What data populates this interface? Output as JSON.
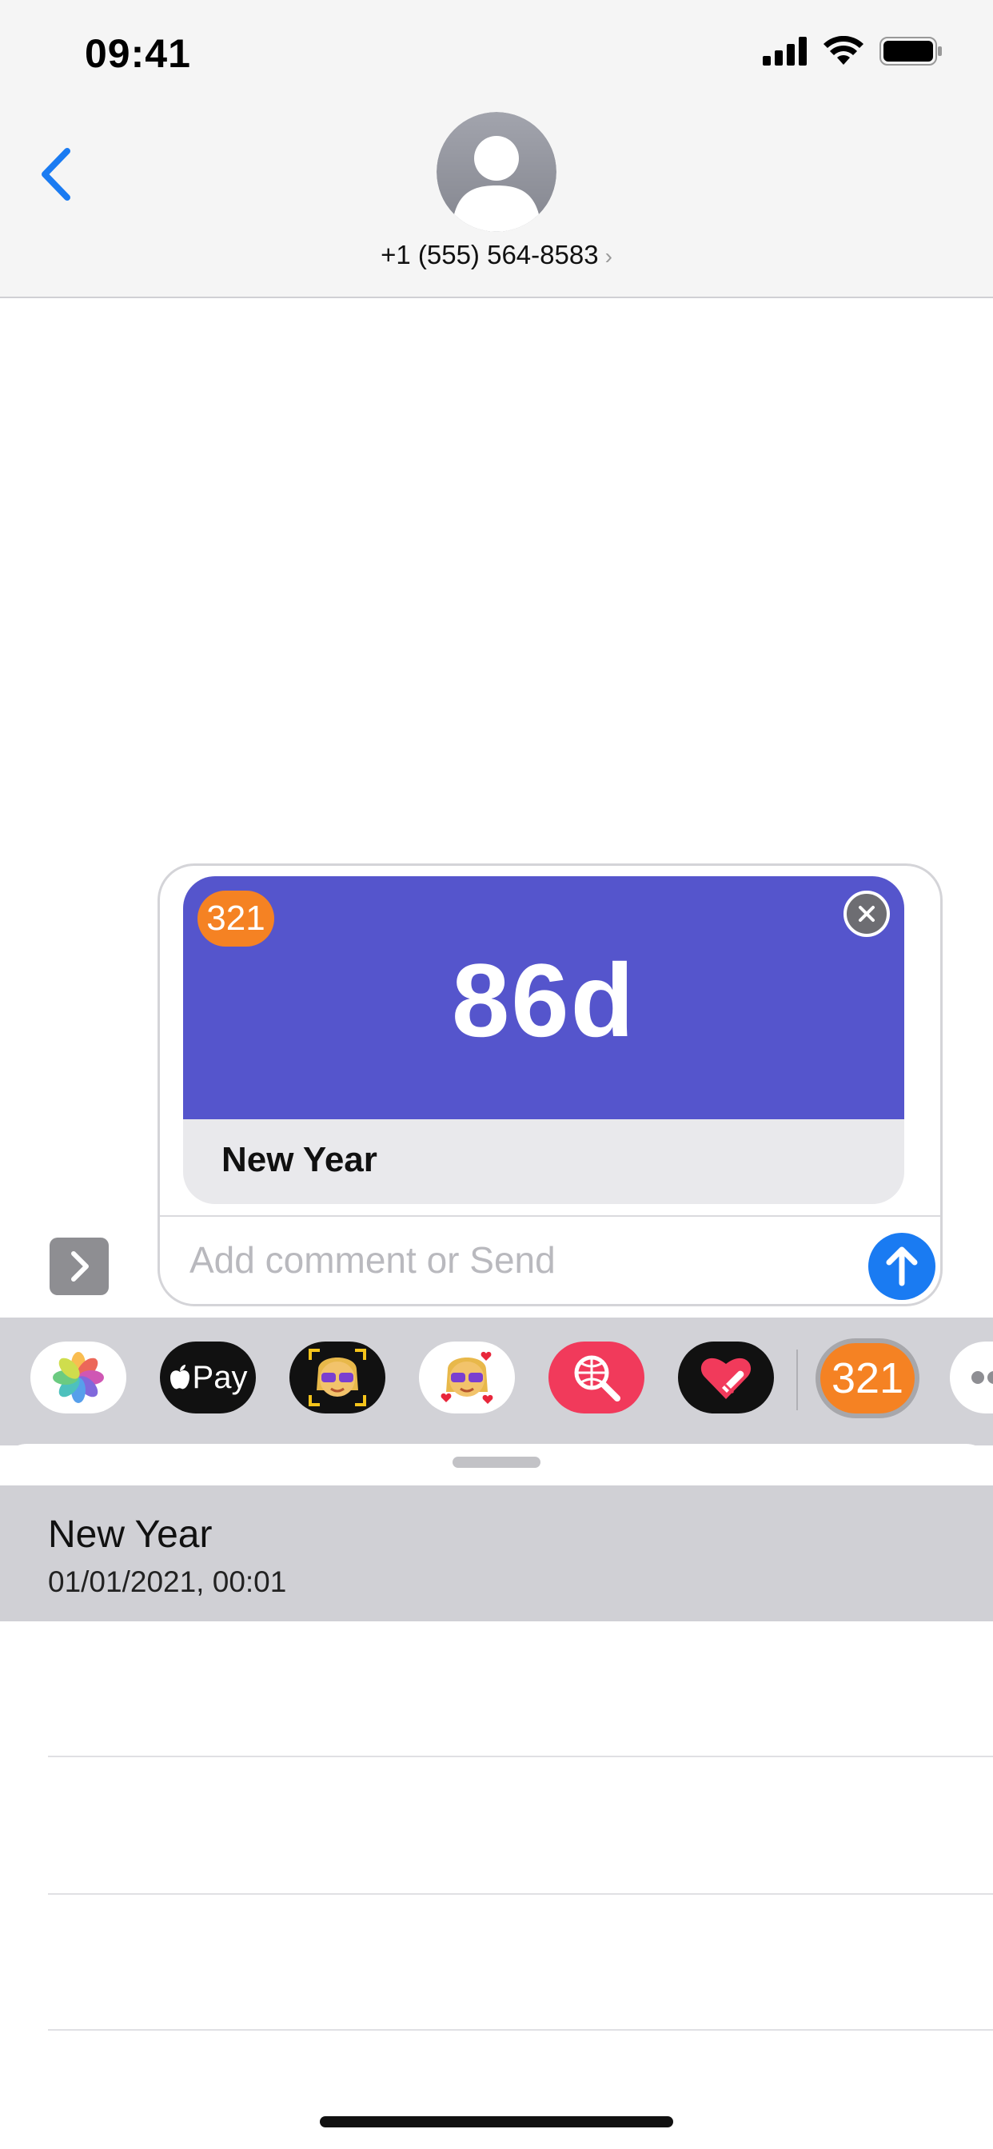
{
  "status_bar": {
    "time": "09:41"
  },
  "header": {
    "contact": "+1 (555) 564-8583",
    "chevron": "›"
  },
  "message_card": {
    "app_badge": "321",
    "countdown": "86d",
    "event_title": "New Year",
    "comment_placeholder": "Add comment or Send"
  },
  "app_drawer": {
    "items": [
      {
        "name": "photos-app-icon"
      },
      {
        "name": "apple-pay-app-icon",
        "label": "Pay"
      },
      {
        "name": "memoji-app-icon"
      },
      {
        "name": "memoji-stickers-app-icon"
      },
      {
        "name": "images-search-app-icon"
      },
      {
        "name": "digital-touch-app-icon"
      },
      {
        "name": "countdown-321-app-icon",
        "label": "321"
      },
      {
        "name": "more-apps-icon"
      }
    ]
  },
  "sheet": {
    "events": [
      {
        "title": "New Year",
        "date": "01/01/2021, 00:01"
      }
    ]
  },
  "colors": {
    "accent_blue": "#1a7bf2",
    "card_purple": "#5555cc",
    "badge_orange": "#f58223"
  }
}
